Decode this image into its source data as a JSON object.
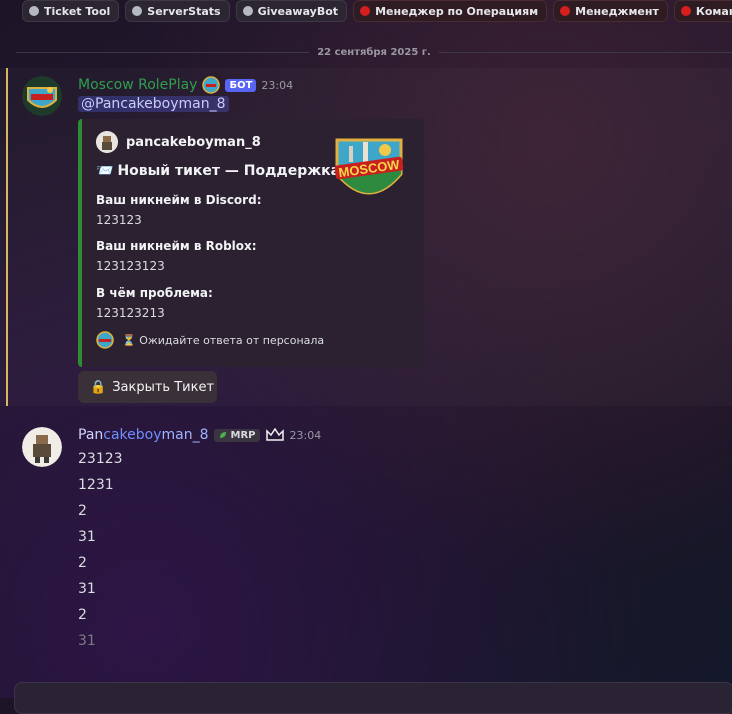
{
  "top_chips": [
    {
      "label": "Ticket Tool",
      "dot": "#b5bac1"
    },
    {
      "label": "ServerStats",
      "dot": "#b5bac1"
    },
    {
      "label": "GiveawayBot",
      "dot": "#b5bac1"
    },
    {
      "label": "Менеджер по Операциям",
      "dot": "#d71e1e"
    },
    {
      "label": "Менеджмент",
      "dot": "#d71e1e"
    },
    {
      "label": "Команда Внутренни",
      "dot": "#d71e1e"
    }
  ],
  "date_divider": "22 сентября 2025 г.",
  "message1": {
    "author": "Moscow RolePlay",
    "author_color": "#2f9e4e",
    "bot_tag": "БОТ",
    "time": "23:04",
    "mention": "@Pancakeboyman_8",
    "embed": {
      "author": "pancakeboyman_8",
      "title_icon": "📨",
      "title": "Новый тикет — Поддержка",
      "thumbnail_text": "MOSCOW",
      "fields": [
        {
          "name": "Ваш никнейм в Discord:",
          "value": "123123"
        },
        {
          "name": "Ваш никнейм в Roblox:",
          "value": "123123123"
        },
        {
          "name": "В чём проблема:",
          "value": "123123213"
        }
      ],
      "footer": "⏳ Ожидайте ответа от персонала",
      "accent": "#2d8d34"
    },
    "button": {
      "icon": "🔒",
      "label": "Закрыть Тикет"
    }
  },
  "message2": {
    "author_a": "Pan",
    "author_b": "cakeboy",
    "author_c": "man_8",
    "tag": "MRP",
    "time": "23:04",
    "lines": [
      "23123",
      "1231",
      "2",
      "31",
      "2",
      "31",
      "2",
      "31"
    ]
  }
}
